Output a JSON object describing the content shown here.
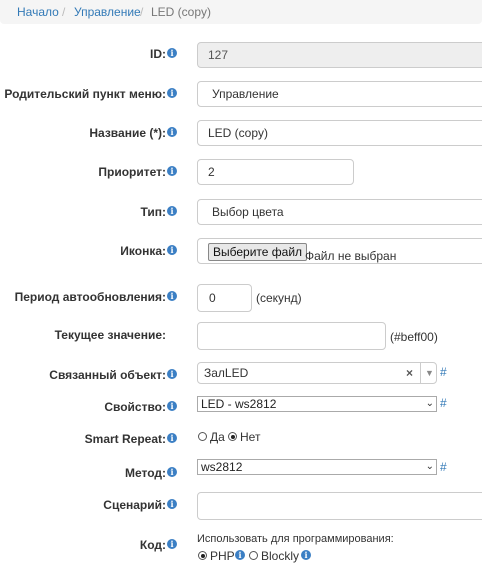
{
  "breadcrumb": {
    "home": "Начало",
    "section": "Управление",
    "separator": "/",
    "current": "LED (copy)"
  },
  "form": {
    "id": {
      "label": "ID:",
      "value": "127"
    },
    "parent_menu": {
      "label": "Родительский пункт меню:",
      "value": "Управление"
    },
    "title": {
      "label": "Название (*):",
      "value": "LED (copy)"
    },
    "priority": {
      "label": "Приоритет:",
      "value": "2"
    },
    "type": {
      "label": "Тип:",
      "value": "Выбор цвета"
    },
    "icon": {
      "label": "Иконка:",
      "button": "Выберите файл",
      "status": "Файл не выбран"
    },
    "autoupdate": {
      "label": "Период автообновления:",
      "value": "0",
      "unit": "(секунд)"
    },
    "current_value": {
      "label": "Текущее значение:",
      "value": "",
      "hint": "(#beff00)"
    },
    "linked_object": {
      "label": "Связанный объект:",
      "value": "ЗалLED",
      "clear": "×",
      "link": "#"
    },
    "property": {
      "label": "Свойство:",
      "value": "LED - ws2812",
      "link": "#"
    },
    "smart_repeat": {
      "label": "Smart Repeat:",
      "yes": "Да",
      "no": "Нет",
      "selected": "no"
    },
    "method": {
      "label": "Метод:",
      "value": "ws2812",
      "link": "#"
    },
    "scenario": {
      "label": "Сценарий:",
      "value": ""
    },
    "code": {
      "label": "Код:",
      "use_for": "Использовать для программирования:",
      "php": "PHP",
      "blockly": "Blockly",
      "selected": "php"
    }
  },
  "icons": {
    "info": "info-circle-icon",
    "chevron": "chevron-down-icon"
  },
  "colors": {
    "link": "#337ab7",
    "info_icon": "#3b7fc4"
  }
}
